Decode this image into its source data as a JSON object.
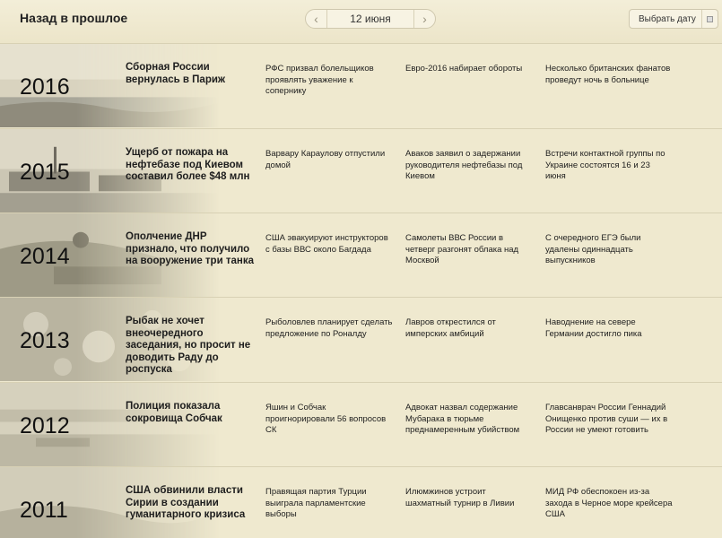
{
  "header": {
    "title": "Назад в прошлое",
    "date": "12 июня",
    "prev_arrow": "‹",
    "next_arrow": "›",
    "pick_date_label": "Выбрать дату",
    "pick_date_icon": "calendar-icon"
  },
  "rows": [
    {
      "year": "2016",
      "lead": "Сборная России вернулась в Париж",
      "news": [
        "РФС призвал болельщиков проявлять уважение к сопернику",
        "Евро-2016 набирает обороты",
        "Несколько британских фанатов проведут ночь в больнице"
      ]
    },
    {
      "year": "2015",
      "lead": "Ущерб от пожара на нефтебазе под Киевом составил более $48 млн",
      "news": [
        "Варвару Караулову отпустили домой",
        "Аваков заявил о задержании руководителя нефтебазы под Киевом",
        "Встречи контактной группы по Украине состоятся 16 и 23 июня"
      ]
    },
    {
      "year": "2014",
      "lead": "Ополчение ДНР признало, что получило на вооружение три танка",
      "news": [
        "США эвакуируют инструкторов с базы ВВС около Багдада",
        "Самолеты ВВС России в четверг разгонят облака над Москвой",
        "С очередного ЕГЭ были удалены одиннадцать выпускников"
      ]
    },
    {
      "year": "2013",
      "lead": "Рыбак не хочет внеочередного заседания, но просит не доводить Раду до роспуска",
      "news": [
        "Рыболовлев планирует сделать предложение по Роналду",
        "Лавров открестился от имперских амбиций",
        "Наводнение на севере Германии достигло пика"
      ]
    },
    {
      "year": "2012",
      "lead": "Полиция показала сокровища Собчак",
      "news": [
        "Яшин и Собчак проигнорировали 56 вопросов СК",
        "Адвокат назвал содержание Мубарака в тюрьме преднамеренным убийством",
        "Главсанврач России Геннадий Онищенко против суши — их в России не умеют готовить"
      ]
    },
    {
      "year": "2011",
      "lead": "США обвинили власти Сирии в создании гуманитарного кризиса",
      "news": [
        "Правящая партия Турции выиграла парламентские выборы",
        "Илюмжинов устроит шахматный турнир в Ливии",
        "МИД РФ обеспокоен из-за захода в Черное море крейсера США"
      ]
    }
  ]
}
